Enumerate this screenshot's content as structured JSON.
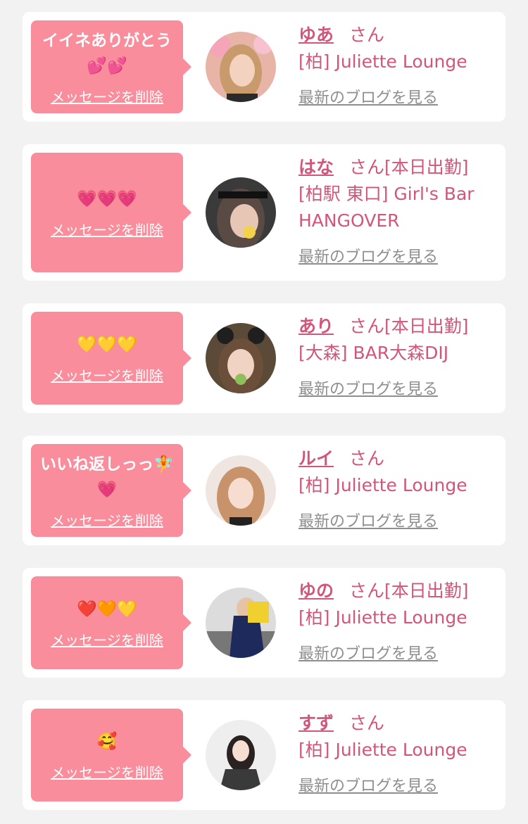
{
  "accent_color": "#f98d9b",
  "name_color": "#d2557a",
  "entries": [
    {
      "message": "イイネありがとう\n💕💕",
      "delete_label": "メッセージを削除",
      "name": "ゆあ",
      "suffix": "さん",
      "shop": "[柏] Juliette Lounge",
      "blog_label": "最新のブログを見る"
    },
    {
      "message": "💗💗💗",
      "delete_label": "メッセージを削除",
      "name": "はな",
      "suffix": "さん[本日出勤]",
      "shop": "[柏駅 東口] Girl's Bar HANGOVER",
      "blog_label": "最新のブログを見る"
    },
    {
      "message": "💛💛💛",
      "delete_label": "メッセージを削除",
      "name": "あり",
      "suffix": "さん[本日出勤]",
      "shop": "[大森] BAR大森DIJ",
      "blog_label": "最新のブログを見る"
    },
    {
      "message": "いいね返しっっ🧚\n💗",
      "delete_label": "メッセージを削除",
      "name": "ルイ",
      "suffix": "さん",
      "shop": "[柏] Juliette Lounge",
      "blog_label": "最新のブログを見る"
    },
    {
      "message": "❤️🧡💛",
      "delete_label": "メッセージを削除",
      "name": "ゆの",
      "suffix": "さん[本日出勤]",
      "shop": "[柏] Juliette Lounge",
      "blog_label": "最新のブログを見る"
    },
    {
      "message": "🥰",
      "delete_label": "メッセージを削除",
      "name": "すず",
      "suffix": "さん",
      "shop": "[柏] Juliette Lounge",
      "blog_label": "最新のブログを見る"
    }
  ]
}
